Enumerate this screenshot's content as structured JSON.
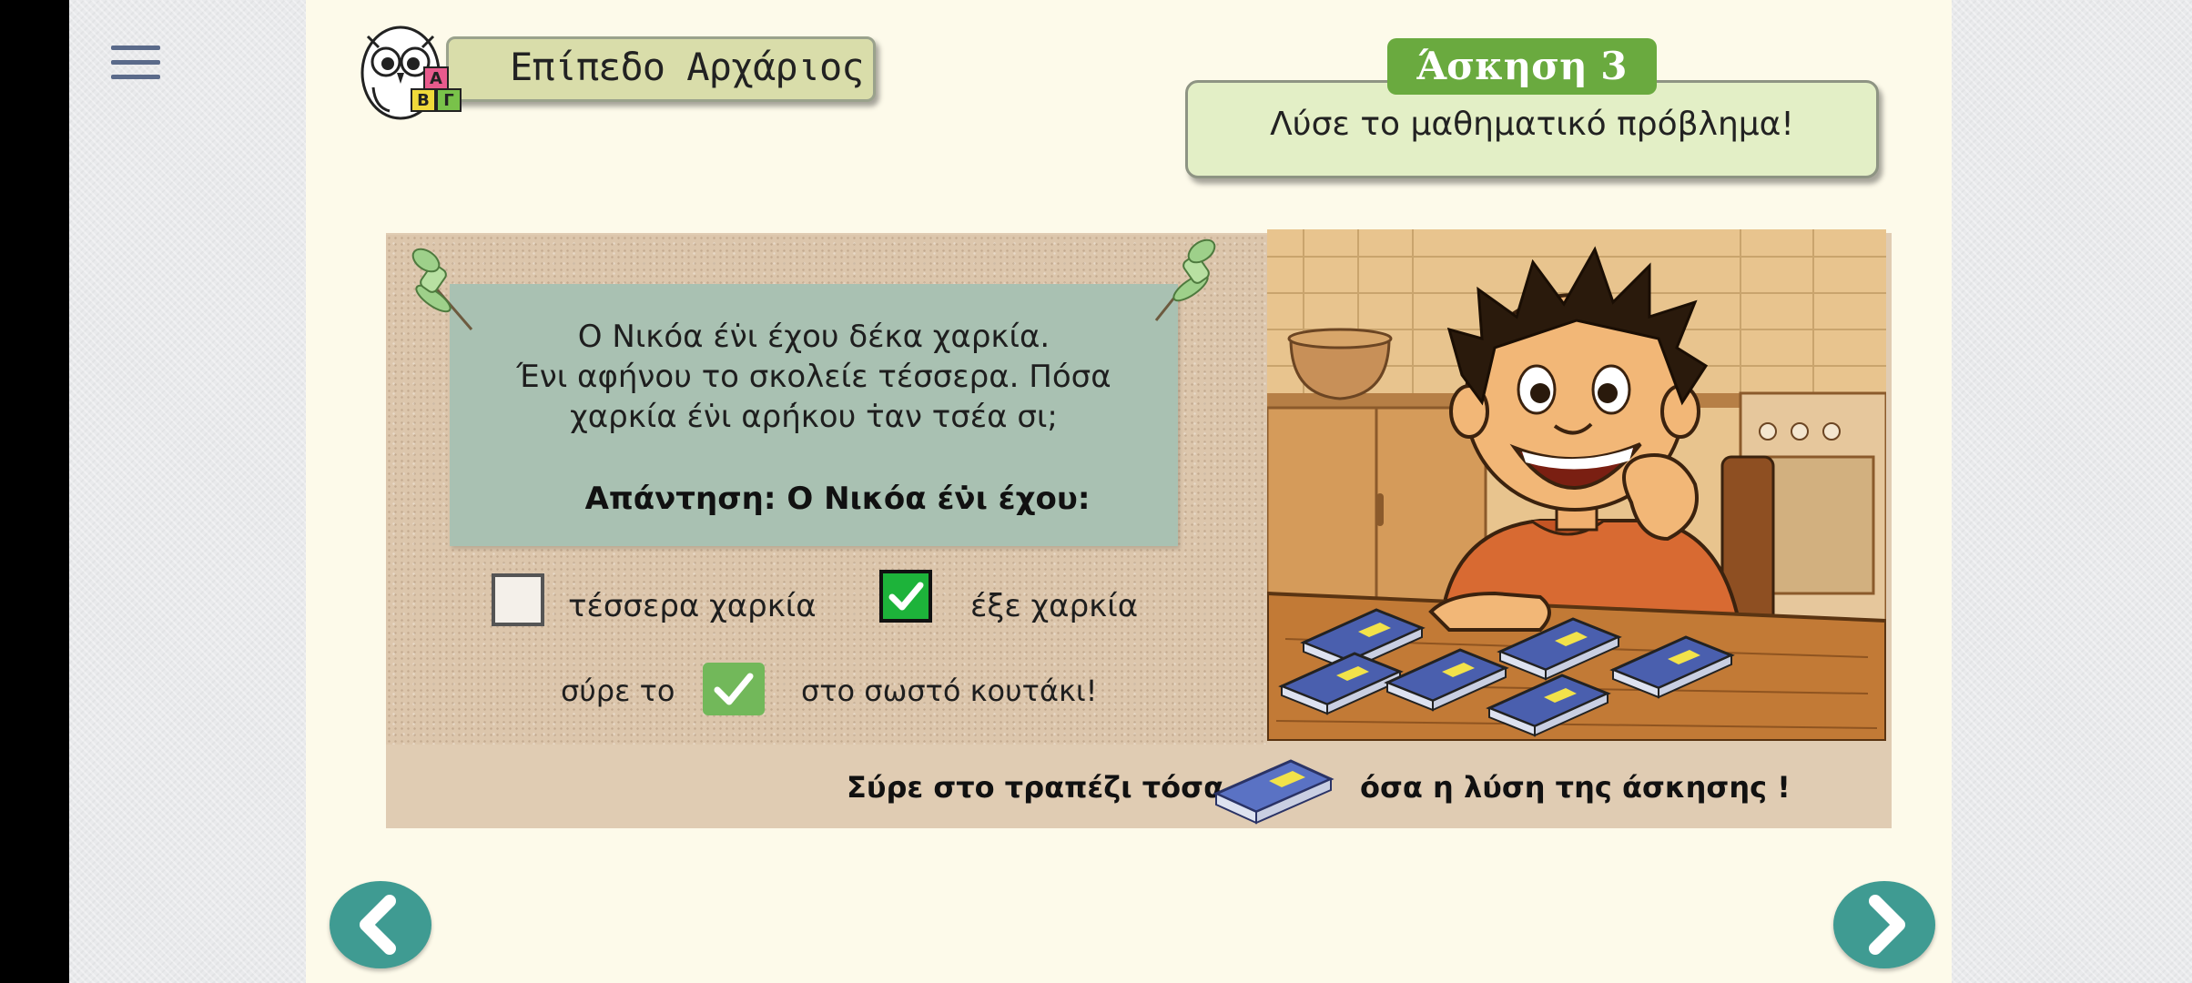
{
  "level": {
    "label": "Επίπεδο Αρχάριος"
  },
  "exercise": {
    "tab": "Άσκηση 3",
    "instruction": "Λύσε το μαθηματικό πρόβλημα!"
  },
  "problem": {
    "lines": [
      "Ο Νικόα έν̇ι έχου δέκα χαρκία.",
      "Ένι αφήνου το σκολείε τέσσερα. Πόσα",
      "χαρκία έν̇ι αρή̇κου τ̇αν τσέα σι;"
    ],
    "answer_lead": "Απάντηση: Ο Νικόα έν̇ι έχου:"
  },
  "options": [
    {
      "label": "τέσσερα χαρκία",
      "checked": false
    },
    {
      "label": "έξε χαρκία",
      "checked": true
    }
  ],
  "drag_hint": {
    "before": "σύρε το",
    "after": "στο σωστό κουτάκι!"
  },
  "bottom_instruction": {
    "before": "Σύρε στο τραπέζι τόσα",
    "after": "όσα η λύση της άσκησης !"
  },
  "owl_blocks": [
    "Α",
    "Β",
    "Γ"
  ],
  "icons": {
    "menu": "hamburger-icon",
    "back": "chevron-left-icon",
    "next": "chevron-right-icon",
    "check": "check-icon",
    "book": "book-icon",
    "pin": "pushpin-icon",
    "owl": "owl-mascot-icon"
  },
  "colors": {
    "accent_green": "#6aaa3f",
    "check_green": "#1db33a",
    "nav_teal": "#3f9b92",
    "book_blue": "#5a72c4",
    "book_yellow": "#f2e24a"
  }
}
